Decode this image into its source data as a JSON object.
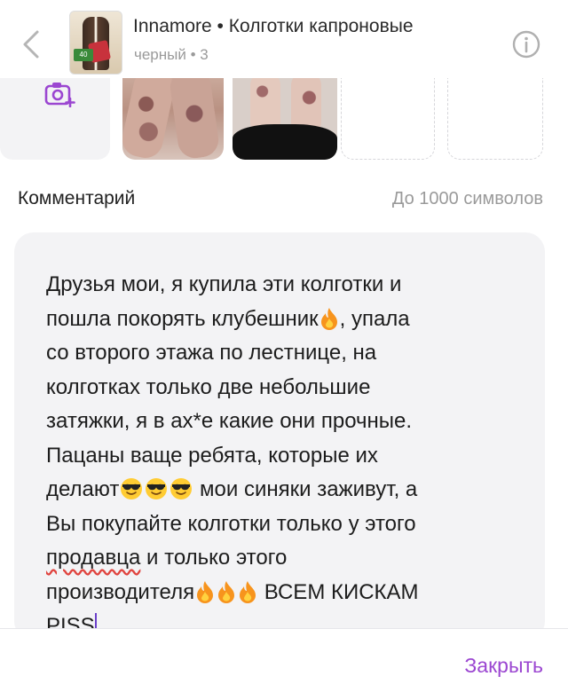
{
  "header": {
    "product_title": "Innamore • Колготки капроновые",
    "variant": "черный • 3",
    "thumbnail_label": "40"
  },
  "photos": {
    "add_photo_icon": "camera-plus-icon",
    "items": [
      "photo-1",
      "photo-2"
    ],
    "empty_slots": 2
  },
  "comment": {
    "label": "Комментарий",
    "hint": "До 1000 символов",
    "lines": {
      "l1": "Друзья мои, я купила эти колготки и",
      "l2a": "пошла покорять клубешник",
      "l2b": ", упала",
      "l3": "со второго этажа по лестнице, на",
      "l4": "колготках только две небольшие",
      "l5": "затяжки, я в ах*е какие они прочные.",
      "l6": "Пацаны ваще ребята, которые их",
      "l7a": "делают",
      "l7b": " мои синяки заживут, а",
      "l8": "Вы покупайте колготки только у этого",
      "l9a": "продавца",
      "l9b": " и только этого",
      "l10a": "производителя",
      "l10b": " ВСЕМ КИСКАМ",
      "l11": "PISS"
    }
  },
  "footer": {
    "close_label": "Закрыть"
  },
  "colors": {
    "accent": "#9b46d1",
    "field_bg": "#f3f3f5",
    "muted_text": "#9a9a9a"
  }
}
